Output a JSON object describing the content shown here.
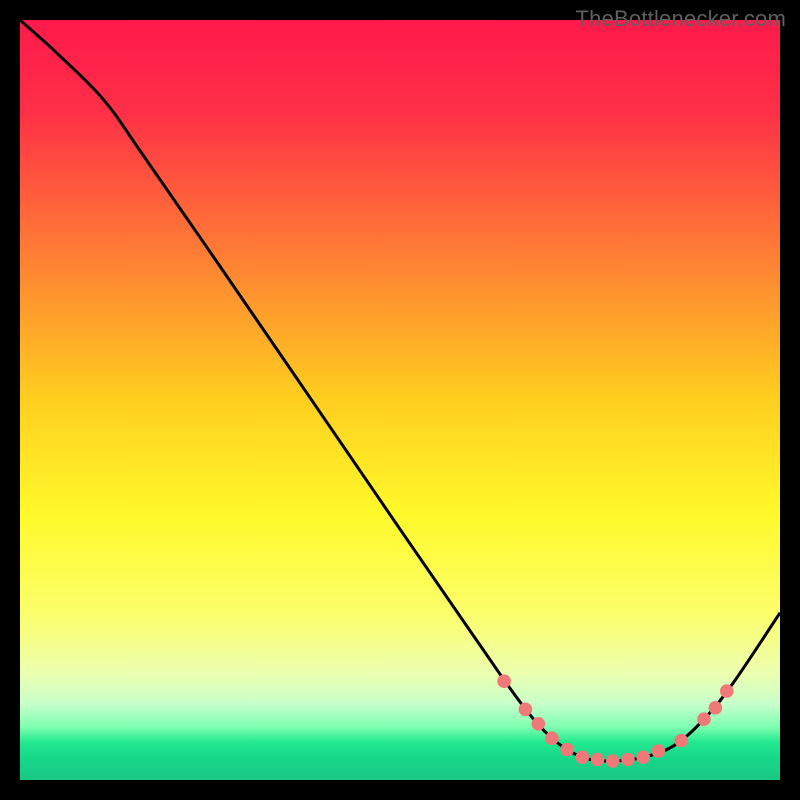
{
  "attribution": "TheBottlenecker.com",
  "chart_data": {
    "type": "line",
    "title": "",
    "xlabel": "",
    "ylabel": "",
    "xlim": [
      0,
      100
    ],
    "ylim": [
      0,
      100
    ],
    "gradient_stops": [
      {
        "pos": 0,
        "color": "#ff1a4b"
      },
      {
        "pos": 12,
        "color": "#ff2f47"
      },
      {
        "pos": 30,
        "color": "#ff7a35"
      },
      {
        "pos": 50,
        "color": "#ffcf1f"
      },
      {
        "pos": 65,
        "color": "#fff92a"
      },
      {
        "pos": 78,
        "color": "#fbff6a"
      },
      {
        "pos": 86,
        "color": "#ecffb0"
      },
      {
        "pos": 90,
        "color": "#c7ffca"
      },
      {
        "pos": 93,
        "color": "#7effb0"
      },
      {
        "pos": 95,
        "color": "#24e98f"
      },
      {
        "pos": 97,
        "color": "#17d889"
      },
      {
        "pos": 100,
        "color": "#18c884"
      }
    ],
    "series": [
      {
        "name": "curve",
        "color": "#000000",
        "points": [
          {
            "x": 0.0,
            "y": 100.0
          },
          {
            "x": 5.0,
            "y": 95.5
          },
          {
            "x": 11.0,
            "y": 89.5
          },
          {
            "x": 16.0,
            "y": 82.5
          },
          {
            "x": 25.0,
            "y": 69.5
          },
          {
            "x": 37.0,
            "y": 52.0
          },
          {
            "x": 50.0,
            "y": 33.0
          },
          {
            "x": 60.0,
            "y": 18.5
          },
          {
            "x": 66.0,
            "y": 10.0
          },
          {
            "x": 70.0,
            "y": 5.5
          },
          {
            "x": 74.0,
            "y": 3.0
          },
          {
            "x": 78.0,
            "y": 2.5
          },
          {
            "x": 82.0,
            "y": 3.0
          },
          {
            "x": 86.0,
            "y": 4.5
          },
          {
            "x": 90.0,
            "y": 8.0
          },
          {
            "x": 94.0,
            "y": 13.0
          },
          {
            "x": 100.0,
            "y": 22.0
          }
        ]
      }
    ],
    "markers": {
      "color": "#f07878",
      "radius_pct": 0.9,
      "points": [
        {
          "x": 63.7,
          "y": 13.0
        },
        {
          "x": 66.5,
          "y": 9.3
        },
        {
          "x": 68.2,
          "y": 7.4
        },
        {
          "x": 70.0,
          "y": 5.5
        },
        {
          "x": 72.0,
          "y": 4.0
        },
        {
          "x": 74.0,
          "y": 3.0
        },
        {
          "x": 76.0,
          "y": 2.7
        },
        {
          "x": 78.0,
          "y": 2.5
        },
        {
          "x": 80.0,
          "y": 2.7
        },
        {
          "x": 82.0,
          "y": 3.0
        },
        {
          "x": 84.0,
          "y": 3.8
        },
        {
          "x": 87.0,
          "y": 5.2
        },
        {
          "x": 90.0,
          "y": 8.0
        },
        {
          "x": 91.5,
          "y": 9.5
        },
        {
          "x": 93.0,
          "y": 11.7
        }
      ]
    }
  }
}
